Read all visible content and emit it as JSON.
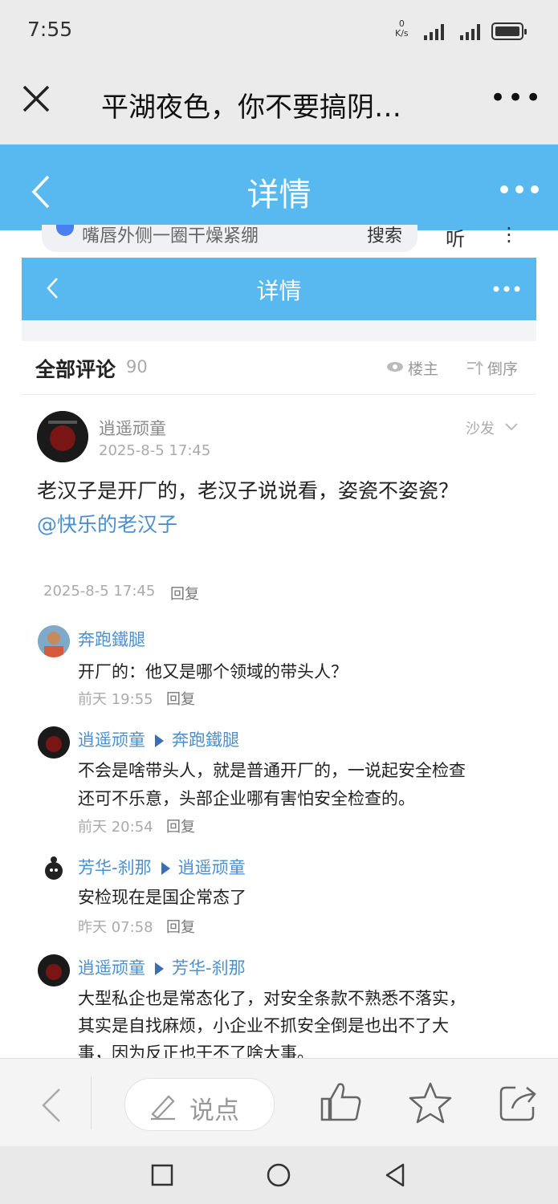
{
  "status_bar": {
    "time": "7:55",
    "net_speed": "0",
    "net_unit": "K/s"
  },
  "title_bar": {
    "title": "平湖夜色，你不要搞阴…",
    "more": "•••"
  },
  "header": {
    "title": "详情"
  },
  "embedded": {
    "search_text": "嘴唇外侧一圈干燥紧绷",
    "search_button": "搜索",
    "topright": "听"
  },
  "embedded_header": {
    "title": "详情"
  },
  "comments": {
    "label": "全部评论",
    "count": "90",
    "owner_filter": "楼主",
    "order": "倒序"
  },
  "main_comment": {
    "user": "逍遥顽童",
    "time": "2025-8-5 17:45",
    "sofa": "沙发",
    "line1": "老汉子是开厂的，老汉子说说看，姿瓷不姿瓷？",
    "mention": "@快乐的老汉子",
    "footer_time": "2025-8-5 17:45",
    "reply": "回复"
  },
  "replies": [
    {
      "user": "奔跑鐵腿",
      "target": "",
      "prefix": "开厂的：",
      "lines": [
        "他又是哪个领域的带头人？"
      ],
      "time": "前天 19:55",
      "reply": "回复"
    },
    {
      "user": "逍遥顽童",
      "target": "奔跑鐵腿",
      "prefix": "",
      "lines": [
        "不会是啥带头人，就是普通开厂的，一说起安全检查",
        "还可不乐意，头部企业哪有害怕安全检查的。"
      ],
      "time": "前天 20:54",
      "reply": "回复"
    },
    {
      "user": "芳华-刹那",
      "target": "逍遥顽童",
      "prefix": "",
      "lines": [
        "安检现在是国企常态了"
      ],
      "time": "昨天 07:58",
      "reply": "回复"
    },
    {
      "user": "逍遥顽童",
      "target": "芳华-刹那",
      "prefix": "",
      "lines": [
        "大型私企也是常态化了，对安全条款不熟悉不落实，",
        "其实是自找麻烦，小企业不抓安全倒是也出不了大",
        "事，因为反正也干不了啥大事。"
      ],
      "time": "",
      "reply": ""
    }
  ],
  "bottom_bar": {
    "say_label": "说点"
  },
  "colors": {
    "header_blue": "#58b8f0",
    "link_blue": "#4a8fd0"
  },
  "icons": [
    "close-icon",
    "more-icon",
    "back-icon",
    "eye-icon",
    "sort-icon",
    "chevron-down-icon",
    "pen-icon",
    "thumbs-up-icon",
    "star-icon",
    "share-icon",
    "square-nav-icon",
    "circle-nav-icon",
    "triangle-nav-icon"
  ]
}
